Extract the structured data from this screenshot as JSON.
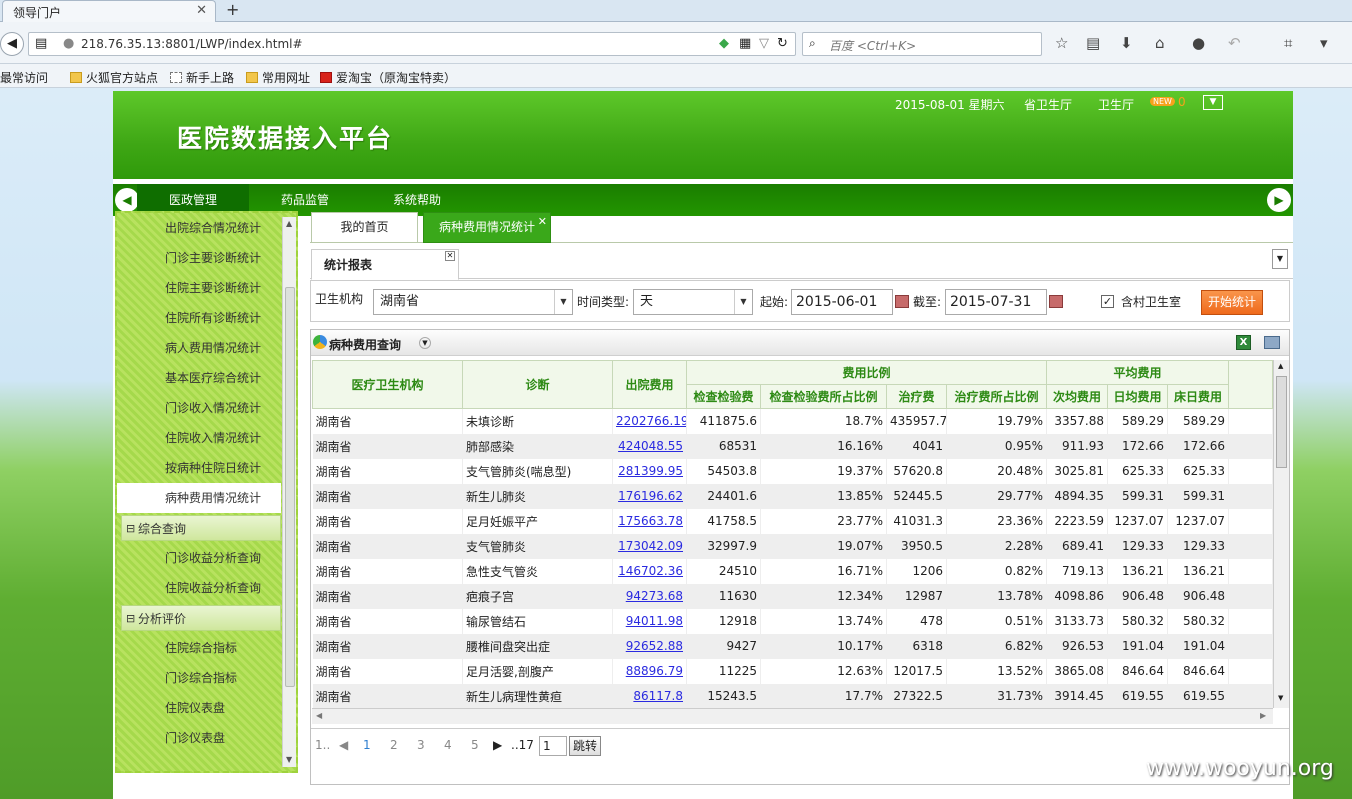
{
  "browser": {
    "tab_title": "领导门户",
    "url": "218.76.35.13:8801/LWP/index.html#",
    "search_placeholder": "百度 <Ctrl+K>",
    "bookmarks": [
      "最常访问",
      "火狐官方站点",
      "新手上路",
      "常用网址",
      "爱淘宝（原淘宝特卖）"
    ]
  },
  "header": {
    "title": "医院数据接入平台",
    "date": "2015-08-01 星期六",
    "org": "省卫生厅",
    "dept": "卫生厅",
    "badge": "NEW",
    "count": "0"
  },
  "menu": [
    "医政管理",
    "药品监管",
    "系统帮助"
  ],
  "sidebar": {
    "items": [
      "出院综合情况统计",
      "门诊主要诊断统计",
      "住院主要诊断统计",
      "住院所有诊断统计",
      "病人费用情况统计",
      "基本医疗综合统计",
      "门诊收入情况统计",
      "住院收入情况统计",
      "按病种住院日统计",
      "病种费用情况统计"
    ],
    "group1": "综合查询",
    "group1_items": [
      "门诊收益分析查询",
      "住院收益分析查询"
    ],
    "group2": "分析评价",
    "group2_items": [
      "住院综合指标",
      "门诊综合指标",
      "住院仪表盘",
      "门诊仪表盘"
    ]
  },
  "tabs": [
    "我的首页",
    "病种费用情况统计"
  ],
  "subtab": "统计报表",
  "filter": {
    "org_label": "卫生机构",
    "org_value": "湖南省",
    "time_label": "时间类型:",
    "time_value": "天",
    "start_label": "起始:",
    "start": "2015-06-01",
    "end_label": "截至:",
    "end": "2015-07-31",
    "checkbox_label": "含村卫生室",
    "button": "开始统计"
  },
  "grid": {
    "title": "病种费用查询",
    "head1": [
      "医疗卫生机构",
      "诊断",
      "出院费用",
      "费用比例",
      "平均费用"
    ],
    "head2": [
      "检查检验费",
      "检查检验费所占比例",
      "治疗费",
      "治疗费所占比例",
      "次均费用",
      "日均费用",
      "床日费用"
    ],
    "rows": [
      [
        "湖南省",
        "未填诊断",
        "2202766.19",
        "411875.6",
        "18.7%",
        "435957.7",
        "19.79%",
        "3357.88",
        "589.29",
        "589.29"
      ],
      [
        "湖南省",
        "肺部感染",
        "424048.55",
        "68531",
        "16.16%",
        "4041",
        "0.95%",
        "911.93",
        "172.66",
        "172.66"
      ],
      [
        "湖南省",
        "支气管肺炎(喘息型)",
        "281399.95",
        "54503.8",
        "19.37%",
        "57620.8",
        "20.48%",
        "3025.81",
        "625.33",
        "625.33"
      ],
      [
        "湖南省",
        "新生儿肺炎",
        "176196.62",
        "24401.6",
        "13.85%",
        "52445.5",
        "29.77%",
        "4894.35",
        "599.31",
        "599.31"
      ],
      [
        "湖南省",
        "足月妊娠平产",
        "175663.78",
        "41758.5",
        "23.77%",
        "41031.3",
        "23.36%",
        "2223.59",
        "1237.07",
        "1237.07"
      ],
      [
        "湖南省",
        "支气管肺炎",
        "173042.09",
        "32997.9",
        "19.07%",
        "3950.5",
        "2.28%",
        "689.41",
        "129.33",
        "129.33"
      ],
      [
        "湖南省",
        "急性支气管炎",
        "146702.36",
        "24510",
        "16.71%",
        "1206",
        "0.82%",
        "719.13",
        "136.21",
        "136.21"
      ],
      [
        "湖南省",
        "疤痕子宫",
        "94273.68",
        "11630",
        "12.34%",
        "12987",
        "13.78%",
        "4098.86",
        "906.48",
        "906.48"
      ],
      [
        "湖南省",
        "输尿管结石",
        "94011.98",
        "12918",
        "13.74%",
        "478",
        "0.51%",
        "3133.73",
        "580.32",
        "580.32"
      ],
      [
        "湖南省",
        "腰椎间盘突出症",
        "92652.88",
        "9427",
        "10.17%",
        "6318",
        "6.82%",
        "926.53",
        "191.04",
        "191.04"
      ],
      [
        "湖南省",
        "足月活婴,剖腹产",
        "88896.79",
        "11225",
        "12.63%",
        "12017.5",
        "13.52%",
        "3865.08",
        "846.64",
        "846.64"
      ],
      [
        "湖南省",
        "新生儿病理性黄疸",
        "86117.8",
        "15243.5",
        "17.7%",
        "27322.5",
        "31.73%",
        "3914.45",
        "619.55",
        "619.55"
      ]
    ]
  },
  "pager": {
    "first": "1..",
    "pages": [
      "1",
      "2",
      "3",
      "4",
      "5"
    ],
    "last": "..17",
    "input": "1",
    "go": "跳转"
  },
  "watermark": "www.wooyun.org"
}
